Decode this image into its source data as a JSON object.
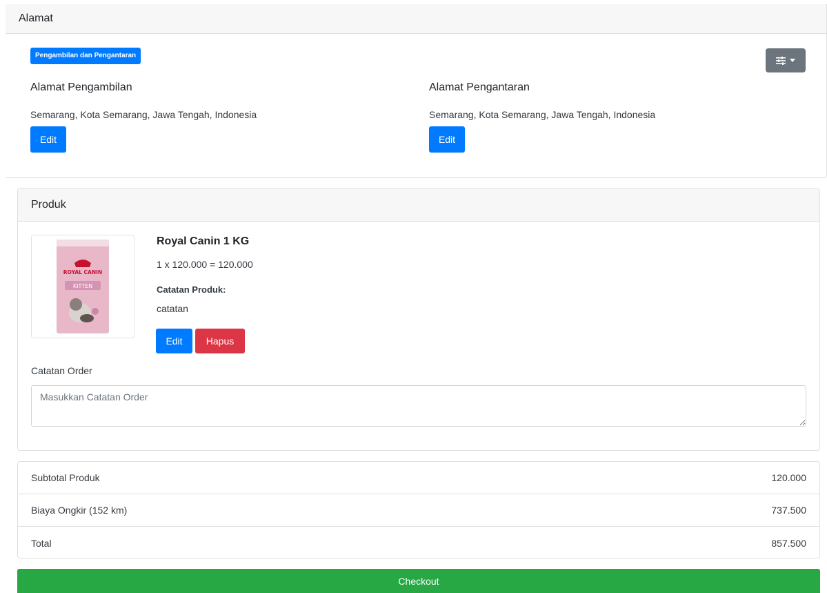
{
  "alamat": {
    "title": "Alamat",
    "badge": "Pengambilan dan Pengantaran",
    "settings_icon": "sliders-icon",
    "pickup": {
      "title": "Alamat Pengambilan",
      "address": "Semarang, Kota Semarang, Jawa Tengah, Indonesia",
      "edit_label": "Edit"
    },
    "delivery": {
      "title": "Alamat Pengantaran",
      "address": "Semarang, Kota Semarang, Jawa Tengah, Indonesia",
      "edit_label": "Edit"
    }
  },
  "produk": {
    "title": "Produk",
    "item": {
      "name": "Royal Canin 1 KG",
      "price_line": "1 x 120.000 = 120.000",
      "note_label": "Catatan Produk:",
      "note": "catatan",
      "image_brand": "ROYAL CANIN",
      "image_variant": "KITTEN",
      "edit_label": "Edit",
      "delete_label": "Hapus"
    },
    "order_note": {
      "label": "Catatan Order",
      "placeholder": "Masukkan Catatan Order",
      "value": ""
    }
  },
  "summary": {
    "rows": [
      {
        "label": "Subtotal Produk",
        "value": "120.000"
      },
      {
        "label": "Biaya Ongkir (152 km)",
        "value": "737.500"
      },
      {
        "label": "Total",
        "value": "857.500"
      }
    ]
  },
  "checkout_label": "Checkout",
  "colors": {
    "primary": "#007bff",
    "danger": "#dc3545",
    "success": "#28a745",
    "secondary": "#6c757d"
  }
}
